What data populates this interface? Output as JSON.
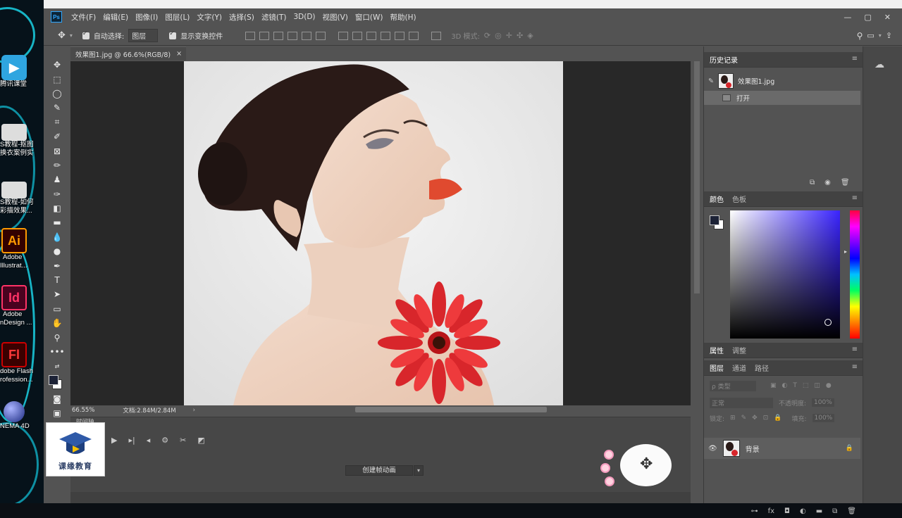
{
  "desktop": {
    "icons": [
      {
        "label": "腾讯课堂",
        "glyph": "▶"
      },
      {
        "label": "S教程-抠图",
        "label2": "换衣案例实",
        "glyph": ""
      },
      {
        "label": "S教程-如何",
        "label2": "彩描效果...",
        "glyph": ""
      },
      {
        "label": "Adobe",
        "label2": "Illustrat...",
        "glyph": "Ai"
      },
      {
        "label": "Adobe",
        "label2": "nDesign ...",
        "glyph": "Id"
      },
      {
        "label": "dobe Flash",
        "label2": "rofession...",
        "glyph": "Fl"
      },
      {
        "label": "NEMA 4D",
        "glyph": ""
      }
    ]
  },
  "menu": {
    "logo": "Ps",
    "items": [
      "文件(F)",
      "编辑(E)",
      "图像(I)",
      "图层(L)",
      "文字(Y)",
      "选择(S)",
      "滤镜(T)",
      "3D(D)",
      "视图(V)",
      "窗口(W)",
      "帮助(H)"
    ],
    "window_buttons": [
      "—",
      "▢",
      "✕"
    ]
  },
  "options": {
    "auto_select_label": "自动选择:",
    "auto_select_value": "图层",
    "show_transform_label": "显示变换控件",
    "mode_3d_label": "3D 模式:"
  },
  "document": {
    "tab_title": "效果图1.jpg @ 66.6%(RGB/8)",
    "tab_close": "×",
    "zoom": "66.55%",
    "doc_info": "文档:2.84M/2.84M"
  },
  "timeline": {
    "tab_label": "时间轴",
    "create_label": "创建帧动画",
    "course_logo_text": "课缘教育"
  },
  "panels": {
    "history": {
      "tab": "历史记录",
      "snapshot": "效果图1.jpg",
      "steps": [
        "打开"
      ]
    },
    "color": {
      "tabs": [
        "颜色",
        "色板"
      ],
      "foreground": "#1c2236",
      "background": "#ffffff"
    },
    "properties": {
      "tabs": [
        "属性",
        "调整"
      ]
    },
    "layers": {
      "tabs": [
        "图层",
        "通道",
        "路径"
      ],
      "filter_placeholder": "ρ 类型",
      "blend_mode": "正常",
      "opacity_label": "不透明度:",
      "opacity_value": "100%",
      "lock_label": "锁定:",
      "fill_label": "填充:",
      "fill_value": "100%",
      "items": [
        {
          "name": "背景",
          "locked": true,
          "visible": true
        }
      ]
    }
  },
  "colors": {
    "accent": "#31a8ff",
    "desktop_swirl": "#19c6d8"
  }
}
